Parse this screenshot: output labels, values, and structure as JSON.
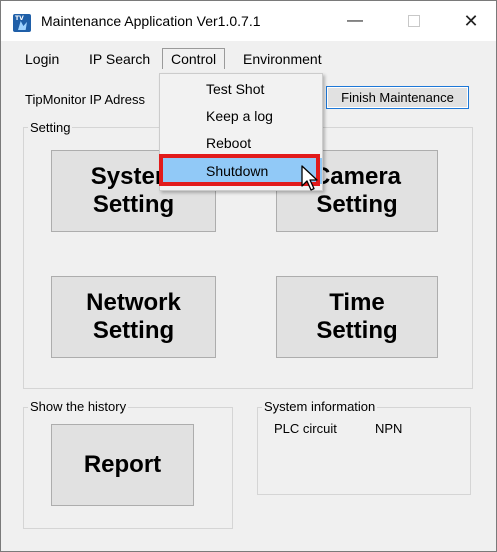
{
  "window": {
    "title": "Maintenance Application Ver1.0.7.1"
  },
  "menubar": {
    "items": [
      "Login",
      "IP Search",
      "Control",
      "Environment"
    ]
  },
  "control_menu": {
    "items": [
      "Test Shot",
      "Keep a log",
      "Reboot",
      "Shutdown"
    ],
    "highlighted": "Shutdown"
  },
  "toolbar": {
    "ip_label": "TipMonitor IP Adress",
    "finish_label": "Finish Maintenance"
  },
  "setting": {
    "group_label": "Setting",
    "buttons": [
      "System\nSetting",
      "Camera\nSetting",
      "Network\nSetting",
      "Time\nSetting"
    ]
  },
  "history": {
    "group_label": "Show the history",
    "report_label": "Report"
  },
  "sysinfo": {
    "group_label": "System information",
    "key": "PLC circuit",
    "value": "NPN"
  },
  "colors": {
    "highlight": "#91c9f7",
    "annotation": "#e11b1b",
    "focus_border": "#1e78d7"
  }
}
